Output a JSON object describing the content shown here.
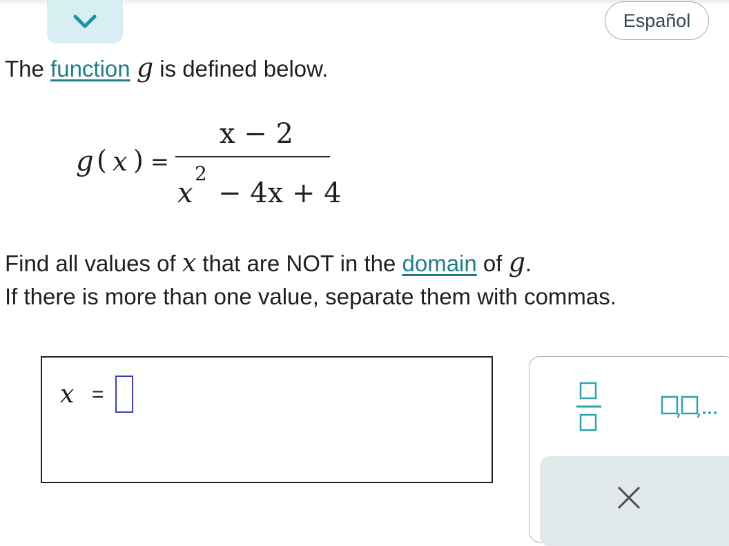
{
  "header": {
    "collapse_icon": "chevron-down-icon",
    "language_label": "Español"
  },
  "intro": {
    "before": "The ",
    "link": "function",
    "var": "g",
    "after": " is defined below."
  },
  "formula": {
    "lhs_fn": "g",
    "lhs_arg": "x",
    "equals": "=",
    "numerator": "x − 2",
    "denominator_term1": "x",
    "denominator_exp": "2",
    "denominator_rest": "− 4x + 4"
  },
  "question": {
    "line1_before": "Find all values of ",
    "line1_var": "x",
    "line1_mid": " that are NOT in the ",
    "line1_link": "domain",
    "line1_after_of": " of ",
    "line1_fn": "g",
    "line1_period": ".",
    "line2": "If there is more than one value, separate them with commas."
  },
  "answer": {
    "var_label": "x",
    "equals": "=",
    "input_value": ""
  },
  "keypad": {
    "fraction_icon": "fraction-template-icon",
    "list_icon": "comma-list-template-icon",
    "clear_icon": "close-icon"
  },
  "colors": {
    "link": "#1f7d8b",
    "collapse_bg": "#d7eef2",
    "keypad_icon": "#2aa3b3",
    "input_border": "#3c3cc4",
    "clear_bg": "#e1e8eb"
  }
}
